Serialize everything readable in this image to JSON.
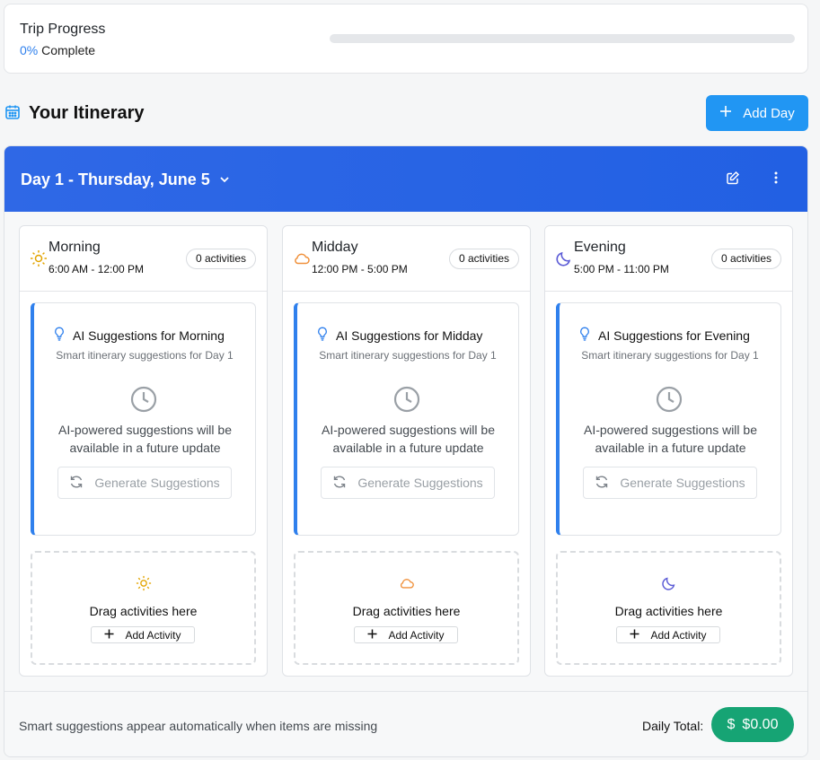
{
  "progress": {
    "title": "Trip Progress",
    "percent_text": "0%",
    "complete_label": "Complete",
    "value": 0
  },
  "itinerary": {
    "title": "Your Itinerary",
    "add_day_label": "Add Day"
  },
  "day": {
    "title": "Day 1 - Thursday, June 5",
    "periods": [
      {
        "name": "Morning",
        "time": "6:00 AM - 12:00 PM",
        "badge": "0 activities",
        "icon": "sun-icon",
        "color": "#e2a400",
        "ai_title": "AI Suggestions for Morning",
        "ai_sub": "Smart itinerary suggestions for Day 1",
        "ai_msg": "AI-powered suggestions will be available in a future update",
        "gen_label": "Generate Suggestions",
        "drop_text": "Drag activities here",
        "add_label": "Add Activity"
      },
      {
        "name": "Midday",
        "time": "12:00 PM - 5:00 PM",
        "badge": "0 activities",
        "icon": "cloud-icon",
        "color": "#f0903a",
        "ai_title": "AI Suggestions for Midday",
        "ai_sub": "Smart itinerary suggestions for Day 1",
        "ai_msg": "AI-powered suggestions will be available in a future update",
        "gen_label": "Generate Suggestions",
        "drop_text": "Drag activities here",
        "add_label": "Add Activity"
      },
      {
        "name": "Evening",
        "time": "5:00 PM - 11:00 PM",
        "badge": "0 activities",
        "icon": "moon-icon",
        "color": "#5b5bd6",
        "ai_title": "AI Suggestions for Evening",
        "ai_sub": "Smart itinerary suggestions for Day 1",
        "ai_msg": "AI-powered suggestions will be available in a future update",
        "gen_label": "Generate Suggestions",
        "drop_text": "Drag activities here",
        "add_label": "Add Activity"
      }
    ],
    "footer": {
      "hint": "Smart suggestions appear automatically when items are missing",
      "total_label": "Daily Total:",
      "currency": "$",
      "total_value": "$0.00"
    }
  },
  "colors": {
    "accent": "#2196f3",
    "header_blue": "#2563eb",
    "ai_border": "#2f80ed",
    "total_green": "#16a474"
  }
}
